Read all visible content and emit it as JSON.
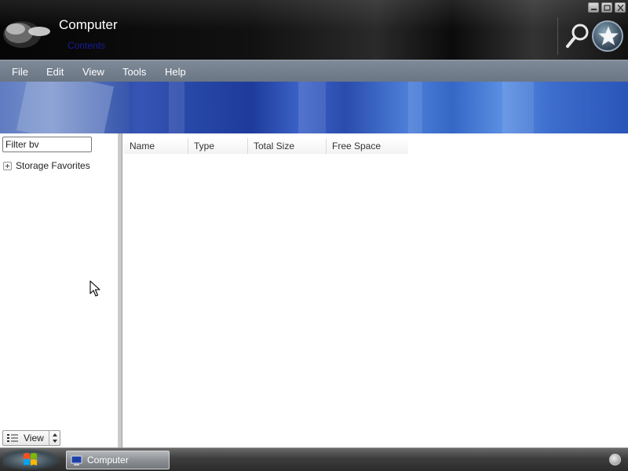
{
  "window": {
    "title": "Computer",
    "subtitle": "Contents",
    "controls": [
      "minimize-icon",
      "maximize-icon",
      "close-icon"
    ]
  },
  "toolbar": {
    "search_icon": "search-icon",
    "favorites_icon": "star-icon"
  },
  "menu": {
    "items": [
      {
        "label": "File"
      },
      {
        "label": "Edit"
      },
      {
        "label": "View"
      },
      {
        "label": "Tools"
      },
      {
        "label": "Help"
      }
    ]
  },
  "sidebar": {
    "filter_value": "Filter bv",
    "tree": [
      {
        "label": "Storage Favorites",
        "icon": "expand-plus-icon"
      }
    ],
    "view_label": "View"
  },
  "list": {
    "columns": [
      "Name",
      "Type",
      "Total Size",
      "Free Space"
    ],
    "rows": []
  },
  "taskbar": {
    "start_icon": "windows-logo-icon",
    "task_label": "Computer",
    "tray_icon": "tray-orb-icon"
  },
  "colors": {
    "menubar": "#74808e",
    "banner": "#2a4cad",
    "titlebar": "#0b0b0b"
  }
}
